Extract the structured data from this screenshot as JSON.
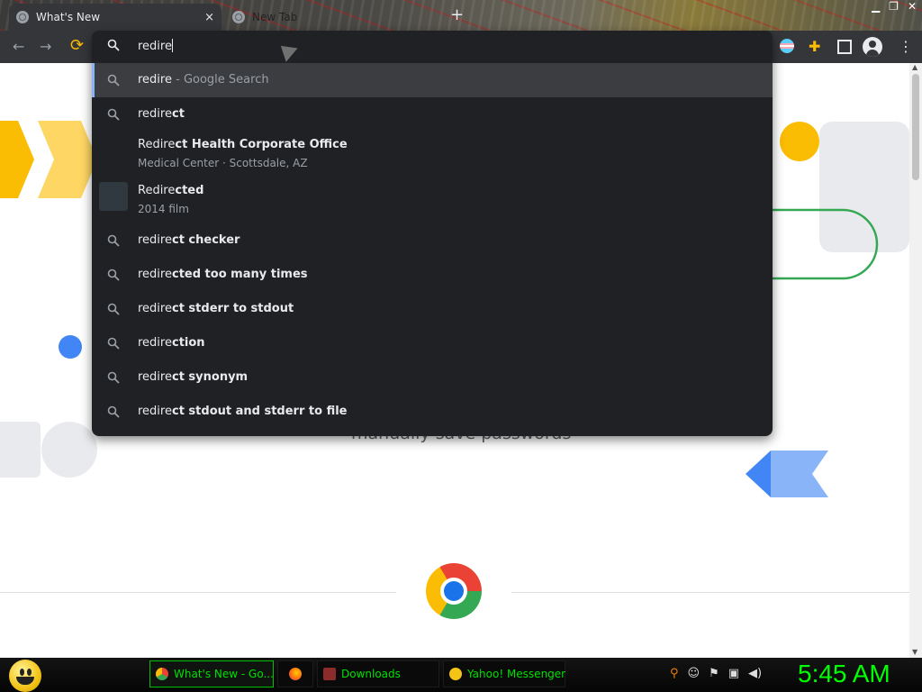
{
  "tabs": [
    {
      "title": "What's New",
      "close": "×",
      "active": true
    },
    {
      "title": "New Tab",
      "active": false
    }
  ],
  "newtab": "+",
  "toolbar": {
    "back_icon": "←",
    "forward_icon": "→",
    "reload_icon": "C",
    "menu_icon": "⋮"
  },
  "omnibox": {
    "input": "redire",
    "suggestions": [
      {
        "typed": "redire",
        "rest": "",
        "hint": " - Google Search",
        "icon": "search-icon"
      },
      {
        "typed": "redire",
        "rest": "ct",
        "icon": "search-icon"
      },
      {
        "typed": "Redire",
        "rest": "ct Health Corporate Office",
        "sub": "Medical Center · Scottsdale, AZ",
        "icon": "none"
      },
      {
        "typed": "Redire",
        "rest": "cted",
        "sub": "2014 film",
        "icon": "thumbnail"
      },
      {
        "typed": "redire",
        "rest": "ct checker",
        "icon": "search-icon"
      },
      {
        "typed": "redire",
        "rest": "cted too many times",
        "icon": "search-icon"
      },
      {
        "typed": "redire",
        "rest": "ct stderr to stdout",
        "icon": "search-icon"
      },
      {
        "typed": "redire",
        "rest": "ction",
        "icon": "search-icon"
      },
      {
        "typed": "redire",
        "rest": "ct synonym",
        "icon": "search-icon"
      },
      {
        "typed": "redire",
        "rest": "ct stdout and stderr to file",
        "icon": "search-icon"
      }
    ]
  },
  "page": {
    "caption": "manually save passwords"
  },
  "taskbar": {
    "buttons": [
      {
        "label": "What's New - Go...",
        "icon": "chrome-icon",
        "active": true
      },
      {
        "label": "",
        "icon": "firefox-icon"
      },
      {
        "label": "Downloads",
        "icon": "downloads-icon"
      },
      {
        "label": "Yahoo! Messenger",
        "icon": "yahoo-messenger-icon"
      }
    ],
    "clock": "5:45 AM"
  },
  "colors": {
    "omnibox_bg": "#202124",
    "selected_row": "#3c3d41",
    "accent_blue": "#8ab4f8",
    "taskbar_text": "#00e000"
  }
}
